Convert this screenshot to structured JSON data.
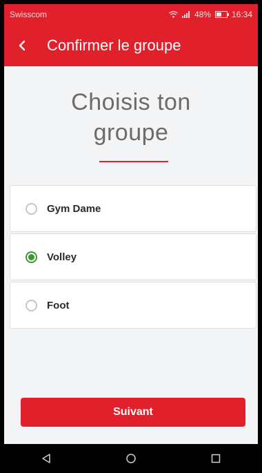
{
  "status_bar": {
    "carrier": "Swisscom",
    "battery": "48%",
    "battery_level": 0.48,
    "time": "16:34"
  },
  "app_bar": {
    "title": "Confirmer le groupe"
  },
  "heading": {
    "line1": "Choisis ton",
    "line2": "groupe"
  },
  "groups": [
    {
      "label": "Gym Dame",
      "selected": false
    },
    {
      "label": "Volley",
      "selected": true
    },
    {
      "label": "Foot",
      "selected": false
    }
  ],
  "next_label": "Suivant",
  "colors": {
    "accent": "#e0202b",
    "selected": "#3c9637"
  },
  "nav_icons": [
    "back-triangle-icon",
    "home-circle-icon",
    "recents-square-icon"
  ]
}
